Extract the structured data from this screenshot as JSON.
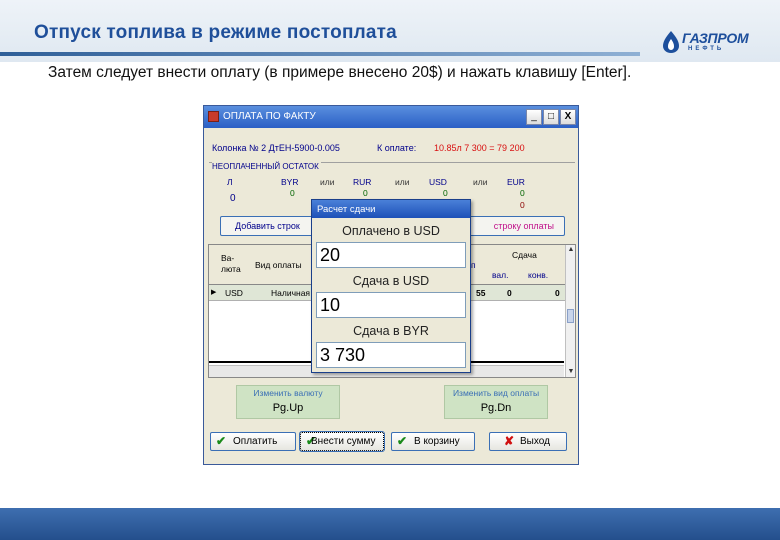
{
  "slide": {
    "title": "Отпуск топлива в режиме постоплата",
    "instruction": "Затем следует внести оплату (в примере внесено 20$) и нажать клавишу [Enter].",
    "logo": {
      "brand": "ГАЗПРОМ",
      "sub": "НЕФТЬ"
    }
  },
  "window": {
    "title": "ОПЛАТА ПО ФАКТУ",
    "buttons": {
      "minimize": "_",
      "maximize": "□",
      "close": "X"
    },
    "info": {
      "column": "Колонка № 2 ДтЕН-5900-0.005",
      "to_pay_label": "К оплате:",
      "to_pay_value": "10.85л  7 300 =  79 200"
    },
    "balance": {
      "legend": "НЕОПЛАЧЕННЫЙ ОСТАТОК",
      "liters_label": "Л",
      "liters_value": "0",
      "or_label": "или",
      "currencies": [
        {
          "code": "BYR",
          "value": "0"
        },
        {
          "code": "RUR",
          "value": "0"
        },
        {
          "code": "USD",
          "value": "0"
        },
        {
          "code": "EUR",
          "value": "0"
        }
      ],
      "extra_value": "0"
    },
    "add_row": {
      "left": "Добавить строк",
      "right": "строку оплаты"
    },
    "grid": {
      "headers": {
        "currency": "Ва-\nлюта",
        "pay_type": "Вид оплаты",
        "col_partial": "п",
        "change_group": "Сдача",
        "change_cur": "вал.",
        "change_conv": "конв."
      },
      "row": {
        "marker": "▶",
        "currency": "USD",
        "pay_type": "Наличная",
        "amount_partial": "55",
        "change_cur": "0",
        "change_conv": "0"
      }
    },
    "keys": {
      "change_currency": {
        "label": "Изменить валюту",
        "key": "Pg.Up"
      },
      "change_pay_type": {
        "label": "Изменить вид оплаты",
        "key": "Pg.Dn"
      }
    },
    "actions": {
      "pay": "Оплатить",
      "enter_sum": "Внести сумму",
      "basket": "В корзину",
      "exit": "Выход"
    }
  },
  "popup": {
    "title": "Расчет сдачи",
    "paid_label": "Оплачено в USD",
    "paid_value": "20",
    "change_usd_label": "Сдача в USD",
    "change_usd_value": "10",
    "change_byr_label": "Сдача в BYR",
    "change_byr_value": "3 730"
  },
  "colors": {
    "title_blue": "#1f4f9a",
    "window_bg": "#ece9d8",
    "titlebar": "#2a5fc5",
    "amount_red": "#d81010",
    "key_box": "#cfe3c4",
    "footer": "#2f5f98"
  }
}
